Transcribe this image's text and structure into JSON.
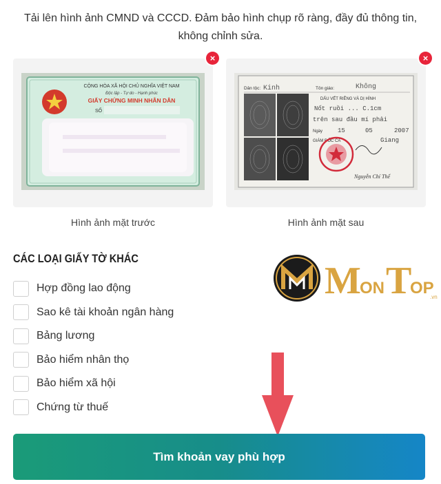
{
  "instructions": "Tải lên hình ảnh CMND và CCCD. Đảm bảo hình chụp rõ ràng, đầy đủ thông tin, không chỉnh sửa.",
  "front": {
    "caption": "Hình ảnh mặt trước",
    "remove_icon": "×",
    "card": {
      "line1": "CỘNG HÒA XÃ HỘI CHỦ NGHĨA VIỆT NAM",
      "line2": "Độc lập - Tự do - Hạnh phúc",
      "title": "GIẤY CHỨNG MINH NHÂN DÂN",
      "number_label": "SỐ"
    }
  },
  "back": {
    "caption": "Hình ảnh mặt sau",
    "remove_icon": "×",
    "card": {
      "ethnicity_label": "Dân tộc:",
      "ethnicity": "Kinh",
      "religion_label": "Tôn giáo:",
      "religion": "Không",
      "marks_title": "DẤU VẾT RIÊNG VÀ DỊ HÌNH",
      "mark1": "Nốt ruồi ... C.1cm",
      "mark2": "trên sau đầu mí phải",
      "date_label": "Ngày",
      "day": "15",
      "month": "05",
      "year": "2007",
      "director": "GIÁM ĐỐC CA",
      "province": "Giang",
      "signature": "Nguyễn Chí Thể"
    }
  },
  "other_docs": {
    "title": "CÁC LOẠI GIẤY TỜ KHÁC",
    "items": [
      {
        "label": "Hợp đồng lao động",
        "checked": false
      },
      {
        "label": "Sao kê tài khoản ngân hàng",
        "checked": false
      },
      {
        "label": "Bảng lương",
        "checked": false
      },
      {
        "label": "Bảo hiểm nhân thọ",
        "checked": false
      },
      {
        "label": "Bảo hiểm xã hội",
        "checked": false
      },
      {
        "label": "Chứng từ thuế",
        "checked": false
      }
    ]
  },
  "watermark": {
    "brand_a": "M",
    "brand_b": "ON",
    "brand_c": "T",
    "brand_d": "OP",
    "suffix": ".vn",
    "color": "#d9a441"
  },
  "arrow_color": "#e8505b",
  "cta": {
    "label": "Tìm khoản vay phù hợp"
  }
}
